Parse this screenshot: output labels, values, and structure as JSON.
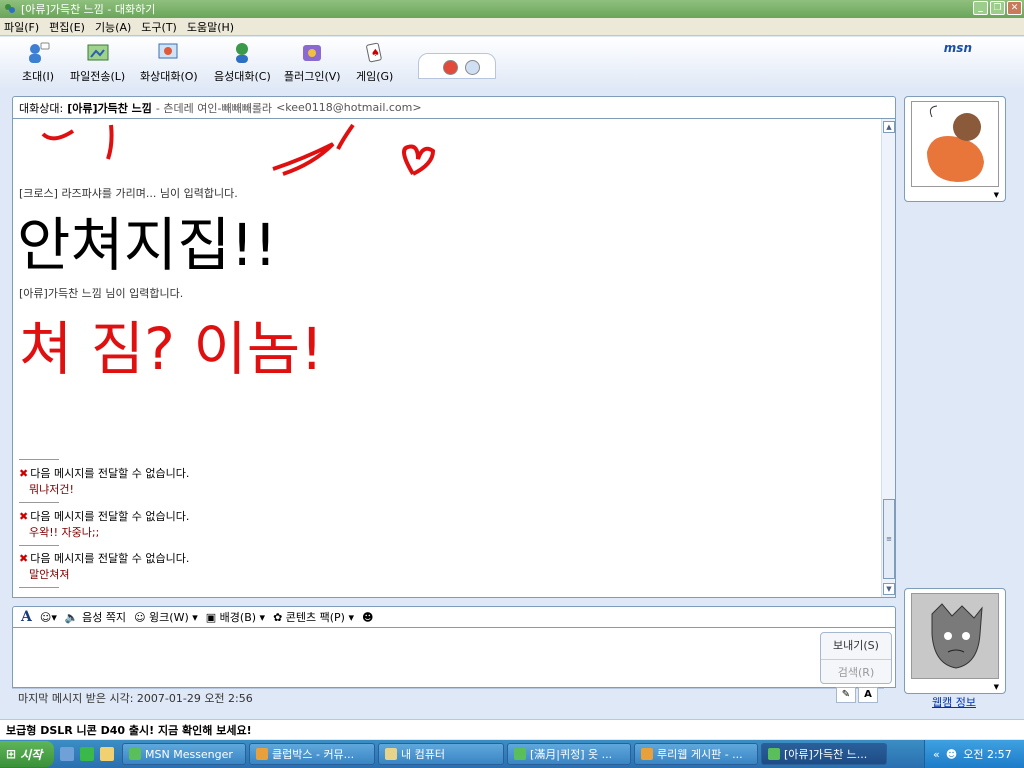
{
  "window": {
    "title": "[아류]가득찬 느낌 - 대화하기"
  },
  "menu": [
    "파일(F)",
    "편집(E)",
    "기능(A)",
    "도구(T)",
    "도움말(H)"
  ],
  "toolbar": {
    "items": [
      {
        "label": "초대(I)",
        "icon": "invite-icon"
      },
      {
        "label": "파일전송(L)",
        "icon": "file-transfer-icon"
      },
      {
        "label": "화상대화(O)",
        "icon": "video-chat-icon"
      },
      {
        "label": "음성대화(C)",
        "icon": "voice-chat-icon"
      },
      {
        "label": "플러그인(V)",
        "icon": "plugin-icon"
      },
      {
        "label": "게임(G)",
        "icon": "game-icon"
      }
    ],
    "brand": "msn"
  },
  "contact": {
    "prefix": "대화상대:",
    "name": "[아류]가득찬 느낌",
    "status": "- 츤데레 여인-빼빼빼롤라",
    "email": "<kee0118@hotmail.com>"
  },
  "chat": {
    "typing1": "[크로스] 라즈파샤를 가리며... 님이 입력합니다.",
    "typing2": "[아류]가득찬 느낌 님이 입력합니다.",
    "ink1": "안쳐지집!!",
    "ink2": "쳐 짐? 이놈!",
    "notices": [
      {
        "text": "다음 메시지를 전달할 수 없습니다.",
        "body": "뭐냐저건!"
      },
      {
        "text": "다음 메시지를 전달할 수 없습니다.",
        "body": "우왁!! 자중나;;"
      },
      {
        "text": "다음 메시지를 전달할 수 없습니다.",
        "body": "말안쳐져"
      }
    ]
  },
  "format": {
    "items": [
      "음성 쪽지",
      "윙크(W)",
      "배경(B)",
      "콘텐츠 팩(P)"
    ]
  },
  "send": {
    "send_label": "보내기(S)",
    "search_label": "검색(R)"
  },
  "status": {
    "last": "마지막 메시지 받은 시각: 2007-01-29 오전 2:56"
  },
  "side": {
    "webcam_label": "웹캠 정보"
  },
  "ad": {
    "text": "보급형 DSLR 니콘 D40 출시! 지금 확인해 보세요!"
  },
  "taskbar": {
    "start": "시작",
    "tasks": [
      {
        "label": "MSN Messenger",
        "active": false
      },
      {
        "label": "클럽박스 - 커뮤...",
        "active": false
      },
      {
        "label": "내 컴퓨터",
        "active": false
      },
      {
        "label": "[滿月|퀴정] 옷 ...",
        "active": false
      },
      {
        "label": "루리웹 게시판 - ...",
        "active": false
      },
      {
        "label": "[아류]가득찬 느...",
        "active": true
      }
    ],
    "clock": "오전 2:57"
  }
}
